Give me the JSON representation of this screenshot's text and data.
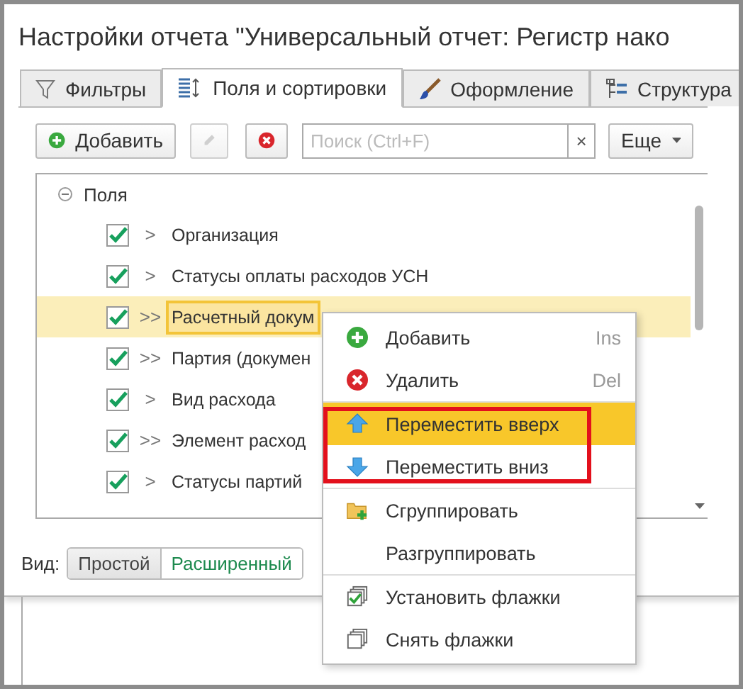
{
  "window": {
    "title": "Настройки отчета \"Универсальный отчет: Регистр нако"
  },
  "tabs": [
    {
      "label": "Фильтры",
      "selected": false
    },
    {
      "label": "Поля и сортировки",
      "selected": true
    },
    {
      "label": "Оформление",
      "selected": false
    },
    {
      "label": "Структура",
      "selected": false
    }
  ],
  "toolbar": {
    "add_button": "Добавить",
    "search": {
      "placeholder": "Поиск (Ctrl+F)",
      "clear": "×"
    },
    "more_button": "Еще"
  },
  "tree": {
    "root": {
      "label": "Поля",
      "expanded": true
    },
    "rows": [
      {
        "label": "Организация",
        "marker": ">",
        "checked": true,
        "selected": false
      },
      {
        "label": "Статусы оплаты расходов УСН",
        "marker": ">",
        "checked": true,
        "selected": false
      },
      {
        "label": "Расчетный докум",
        "marker": ">>",
        "checked": true,
        "selected": true
      },
      {
        "label": "Партия (докумен",
        "marker": ">>",
        "checked": true,
        "selected": false
      },
      {
        "label": "Вид расхода",
        "marker": ">",
        "checked": true,
        "selected": false
      },
      {
        "label": "Элемент расход",
        "marker": ">>",
        "checked": true,
        "selected": false
      },
      {
        "label": "Статусы партий",
        "marker": ">",
        "checked": true,
        "selected": false
      }
    ]
  },
  "view": {
    "label": "Вид:",
    "options": [
      {
        "label": "Простой",
        "selected": true
      },
      {
        "label": "Расширенный",
        "selected": false
      }
    ]
  },
  "context_menu": {
    "groups": [
      {
        "framed": false,
        "items": [
          {
            "label": "Добавить",
            "shortcut": "Ins",
            "selected": false
          },
          {
            "label": "Удалить",
            "shortcut": "Del",
            "selected": false
          }
        ]
      },
      {
        "framed": true,
        "items": [
          {
            "label": "Переместить вверх",
            "selected": true
          },
          {
            "label": "Переместить вниз",
            "selected": false
          }
        ]
      },
      {
        "framed": false,
        "items": [
          {
            "label": "Сгруппировать",
            "selected": false
          },
          {
            "label": "Разгруппировать",
            "selected": false
          }
        ]
      },
      {
        "framed": false,
        "items": [
          {
            "label": "Установить флажки",
            "selected": false
          },
          {
            "label": "Снять флажки",
            "selected": false
          }
        ]
      }
    ]
  }
}
